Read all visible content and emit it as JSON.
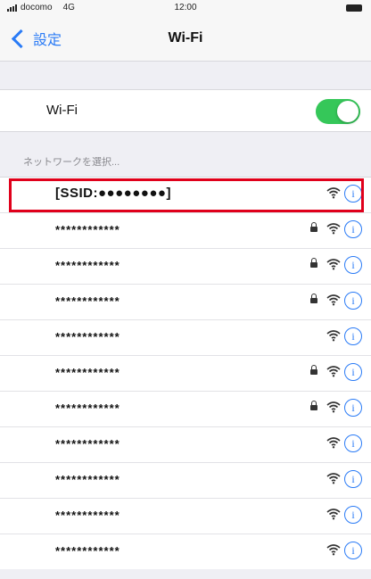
{
  "status_bar": {
    "carrier": "docomo",
    "network": "4G",
    "time": "12:00"
  },
  "nav": {
    "back_label": "設定",
    "title": "Wi-Fi"
  },
  "wifi_toggle": {
    "label": "Wi-Fi",
    "state": "on",
    "on_color": "#35c759"
  },
  "section_header": "ネットワークを選択...",
  "networks": [
    {
      "name": "[SSID:●●●●●●●●]",
      "locked": false,
      "highlighted": true
    },
    {
      "name": "************",
      "locked": true,
      "highlighted": false
    },
    {
      "name": "************",
      "locked": true,
      "highlighted": false
    },
    {
      "name": "************",
      "locked": true,
      "highlighted": false
    },
    {
      "name": "************",
      "locked": false,
      "highlighted": false
    },
    {
      "name": "************",
      "locked": true,
      "highlighted": false
    },
    {
      "name": "************",
      "locked": true,
      "highlighted": false
    },
    {
      "name": "************",
      "locked": false,
      "highlighted": false
    },
    {
      "name": "************",
      "locked": false,
      "highlighted": false
    },
    {
      "name": "************",
      "locked": false,
      "highlighted": false
    },
    {
      "name": "************",
      "locked": false,
      "highlighted": false
    }
  ],
  "icons": {
    "info": "i",
    "lock": "lock-icon",
    "wifi": "wifi-icon"
  },
  "colors": {
    "accent": "#2a7bf6",
    "highlight_border": "#e0001b"
  }
}
